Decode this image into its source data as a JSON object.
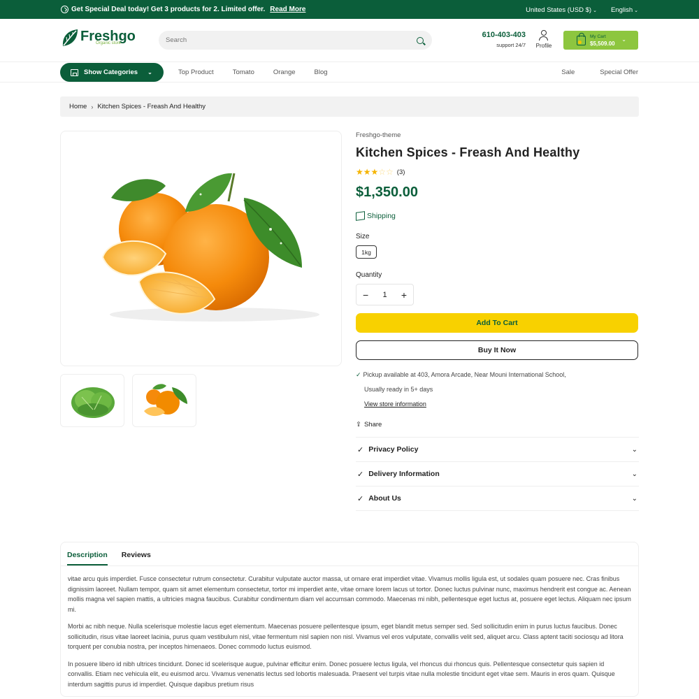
{
  "topbar": {
    "promo_text": "Get Special Deal today! Get 3 products for 2. Limited offer.",
    "promo_link": "Read More",
    "currency": "United States (USD $)",
    "language": "English"
  },
  "header": {
    "logo_name": "Freshgo",
    "logo_tagline": "Organic store",
    "search_placeholder": "Search",
    "phone": "610-403-403",
    "support": "support 24/7",
    "profile_label": "Profile",
    "cart_label": "My Cart",
    "cart_total": "$5,509.00"
  },
  "nav": {
    "categories_label": "Show Categories",
    "links": [
      "Top Product",
      "Tomato",
      "Orange",
      "Blog"
    ],
    "right_links": [
      "Sale",
      "Special Offer"
    ]
  },
  "breadcrumb": {
    "home": "Home",
    "current": "Kitchen Spices - Freash And Healthy"
  },
  "product": {
    "vendor": "Freshgo-theme",
    "title": "Kitchen Spices - Freash And Healthy",
    "rating": 3,
    "rating_max": 5,
    "review_count": "(3)",
    "price": "$1,350.00",
    "shipping_label": "Shipping",
    "size_label": "Size",
    "size_value": "1kg",
    "quantity_label": "Quantity",
    "quantity": "1",
    "add_to_cart": "Add To Cart",
    "buy_now": "Buy It Now",
    "pickup_line1": "Pickup available at 403, Amora Arcade, Near Mouni International School,",
    "pickup_line2": "Usually ready in 5+ days",
    "store_info_link": "View store information",
    "share_label": "Share",
    "accordion": [
      "Privacy Policy",
      "Delivery Information",
      "About Us"
    ]
  },
  "tabs": {
    "description": "Description",
    "reviews": "Reviews"
  },
  "description_paragraphs": [
    "vitae arcu quis imperdiet. Fusce consectetur rutrum consectetur. Curabitur vulputate auctor massa, ut ornare erat imperdiet vitae. Vivamus mollis ligula est, ut sodales quam posuere nec. Cras finibus dignissim laoreet. Nullam tempor, quam sit amet elementum consectetur, tortor mi imperdiet ante, vitae ornare lorem lacus ut tortor. Donec luctus pulvinar nunc, maximus hendrerit est congue ac. Aenean mollis magna vel sapien mattis, a ultricies magna faucibus. Curabitur condimentum diam vel accumsan commodo. Maecenas mi nibh, pellentesque eget luctus at, posuere eget lectus. Aliquam nec ipsum mi.",
    "Morbi ac nibh neque. Nulla scelerisque molestie lacus eget elementum. Maecenas posuere pellentesque ipsum, eget blandit metus semper sed. Sed sollicitudin enim in purus luctus faucibus. Donec sollicitudin, risus vitae laoreet lacinia, purus quam vestibulum nisl, vitae fermentum nisl sapien non nisl. Vivamus vel eros vulputate, convallis velit sed, aliquet arcu. Class aptent taciti sociosqu ad litora torquent per conubia nostra, per inceptos himenaeos. Donec commodo luctus euismod.",
    "In posuere libero id nibh ultrices tincidunt. Donec id scelerisque augue, pulvinar efficitur enim. Donec posuere lectus ligula, vel rhoncus dui rhoncus quis. Pellentesque consectetur quis sapien id convallis. Etiam nec vehicula elit, eu euismod arcu. Vivamus venenatis lectus sed lobortis malesuada. Praesent vel turpis vitae nulla molestie tincidunt eget vitae sem. Mauris in eros quam. Quisque interdum sagittis purus id imperdiet. Quisque dapibus pretium risus"
  ],
  "colors": {
    "brand_green": "#0b5e3a",
    "accent_lime": "#8dc63f",
    "cta_yellow": "#f8d100",
    "star": "#f5b400"
  }
}
